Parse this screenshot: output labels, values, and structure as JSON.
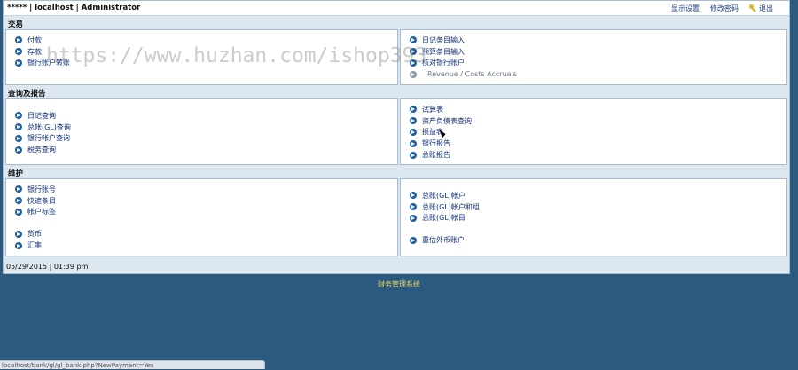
{
  "header": {
    "title": "***** | localhost | Administrator",
    "display_settings": "显示设置",
    "change_password": "修改密码",
    "logout": "退出"
  },
  "sections": [
    {
      "title": "交易",
      "left": [
        {
          "label": "付款"
        },
        {
          "label": "存款"
        },
        {
          "label": "银行账户转账"
        }
      ],
      "right": [
        {
          "label": "日记条目输入"
        },
        {
          "label": "预算条目输入"
        },
        {
          "label": "核对银行账户"
        },
        {
          "label": "Revenue / Costs Accruals"
        }
      ]
    },
    {
      "title": "查询及报告",
      "left": [
        {
          "label": "日记查询"
        },
        {
          "label": "总帐(GL)查询"
        },
        {
          "label": "银行帐户查询"
        },
        {
          "label": "税务查询"
        }
      ],
      "right": [
        {
          "label": "试算表"
        },
        {
          "label": "资产负债表查询"
        },
        {
          "label": "损益表"
        },
        {
          "label": "银行报告"
        },
        {
          "label": "总账报告"
        }
      ]
    },
    {
      "title": "维护",
      "left": [
        {
          "label": "银行账号"
        },
        {
          "label": "快速条目"
        },
        {
          "label": "帐户标签"
        },
        {
          "label": "货币"
        },
        {
          "label": "汇率"
        }
      ],
      "right": [
        {
          "label": "总账(GL)帐户"
        },
        {
          "label": "总账(GL)帐户和组"
        },
        {
          "label": "总账(GL)帐目"
        },
        {
          "label": "重估外币账户"
        }
      ]
    }
  ],
  "status": {
    "date": "05/29/2015",
    "time": "01:39 pm"
  },
  "footer": "财务管理系统",
  "status_url": "localhost/bank/gl/gl_bank.php?NewPayment=Yes",
  "watermark": "https://www.huzhan.com/ishop393"
}
